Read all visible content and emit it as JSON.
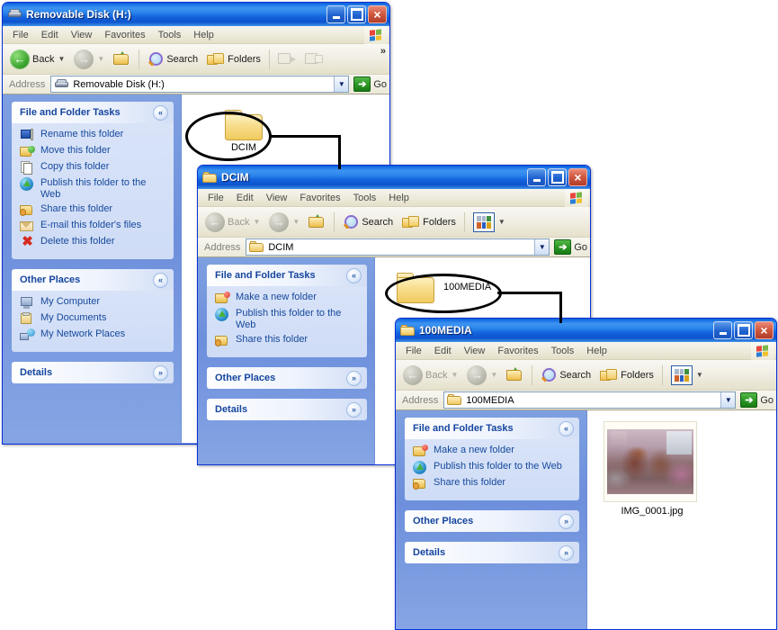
{
  "windows": [
    {
      "id": "removable-disk",
      "title": "Removable Disk (H:)",
      "title_icon": "drive-icon",
      "menu": [
        "File",
        "Edit",
        "View",
        "Favorites",
        "Tools",
        "Help"
      ],
      "toolbar": {
        "back_label": "Back",
        "back_enabled": true,
        "forward_enabled": false,
        "search_label": "Search",
        "folders_label": "Folders",
        "more_chevron": "»",
        "has_views_button": false,
        "has_move_copy": true
      },
      "address": {
        "label": "Address",
        "value": "Removable Disk (H:)",
        "icon": "drive-icon",
        "go_label": "Go"
      },
      "panels": [
        {
          "title": "File and Folder Tasks",
          "state": "expanded",
          "chevron": "«",
          "items": [
            {
              "label": "Rename this folder",
              "icon": "rename-icon"
            },
            {
              "label": "Move this folder",
              "icon": "move-icon"
            },
            {
              "label": "Copy this folder",
              "icon": "copy-icon"
            },
            {
              "label": "Publish this folder to the Web",
              "icon": "publish-icon"
            },
            {
              "label": "Share this folder",
              "icon": "share-icon"
            },
            {
              "label": "E-mail this folder's files",
              "icon": "mail-icon"
            },
            {
              "label": "Delete this folder",
              "icon": "delete-icon"
            }
          ]
        },
        {
          "title": "Other Places",
          "state": "expanded",
          "chevron": "«",
          "items": [
            {
              "label": "My Computer",
              "icon": "my-computer-icon"
            },
            {
              "label": "My Documents",
              "icon": "my-documents-icon"
            },
            {
              "label": "My Network Places",
              "icon": "network-places-icon"
            }
          ]
        },
        {
          "title": "Details",
          "state": "collapsed",
          "chevron": "»",
          "items": []
        }
      ],
      "files": [
        {
          "name": "DCIM",
          "type": "folder",
          "view": "tiles"
        }
      ]
    },
    {
      "id": "dcim",
      "title": "DCIM",
      "title_icon": "folder-icon",
      "menu": [
        "File",
        "Edit",
        "View",
        "Favorites",
        "Tools",
        "Help"
      ],
      "toolbar": {
        "back_label": "Back",
        "back_enabled": false,
        "forward_enabled": false,
        "search_label": "Search",
        "folders_label": "Folders",
        "more_chevron": "",
        "has_views_button": true,
        "has_move_copy": false
      },
      "address": {
        "label": "Address",
        "value": "DCIM",
        "icon": "folder-icon",
        "go_label": "Go"
      },
      "panels": [
        {
          "title": "File and Folder Tasks",
          "state": "expanded",
          "chevron": "«",
          "items": [
            {
              "label": "Make a new folder",
              "icon": "new-folder-icon"
            },
            {
              "label": "Publish this folder to the Web",
              "icon": "publish-icon"
            },
            {
              "label": "Share this folder",
              "icon": "share-icon"
            }
          ]
        },
        {
          "title": "Other Places",
          "state": "collapsed",
          "chevron": "»",
          "items": []
        },
        {
          "title": "Details",
          "state": "collapsed",
          "chevron": "»",
          "items": []
        }
      ],
      "files": [
        {
          "name": "100MEDIA",
          "type": "folder",
          "view": "list"
        }
      ]
    },
    {
      "id": "media100",
      "title": "100MEDIA",
      "title_icon": "folder-icon",
      "menu": [
        "File",
        "Edit",
        "View",
        "Favorites",
        "Tools",
        "Help"
      ],
      "toolbar": {
        "back_label": "Back",
        "back_enabled": false,
        "forward_enabled": false,
        "search_label": "Search",
        "folders_label": "Folders",
        "more_chevron": "",
        "has_views_button": true,
        "has_move_copy": false
      },
      "address": {
        "label": "Address",
        "value": "100MEDIA",
        "icon": "folder-icon",
        "go_label": "Go"
      },
      "panels": [
        {
          "title": "File and Folder Tasks",
          "state": "expanded",
          "chevron": "«",
          "items": [
            {
              "label": "Make a new folder",
              "icon": "new-folder-icon"
            },
            {
              "label": "Publish this folder to the Web",
              "icon": "publish-icon"
            },
            {
              "label": "Share this folder",
              "icon": "share-icon"
            }
          ]
        },
        {
          "title": "Other Places",
          "state": "collapsed",
          "chevron": "»",
          "items": []
        },
        {
          "title": "Details",
          "state": "collapsed",
          "chevron": "»",
          "items": []
        }
      ],
      "files": [
        {
          "name": "IMG_0001.jpg",
          "type": "image",
          "view": "thumbnail"
        }
      ]
    }
  ],
  "window_buttons": {
    "minimize": "minimize-button",
    "maximize": "maximize-button",
    "close": "×"
  },
  "annotations": {
    "circle_dcim": "ellipse around DCIM folder",
    "circle_100media": "ellipse around 100MEDIA folder",
    "connector_1": "line from DCIM circle to DCIM window",
    "connector_2": "line from 100MEDIA circle to 100MEDIA window"
  },
  "colors": {
    "titlebar_blue": "#2b85ec",
    "sidebar_blue": "#7ea0e0",
    "panel_header": "#15459e",
    "link_blue": "#16499c",
    "annotation": "#000000",
    "go_green": "#2e9b27"
  }
}
